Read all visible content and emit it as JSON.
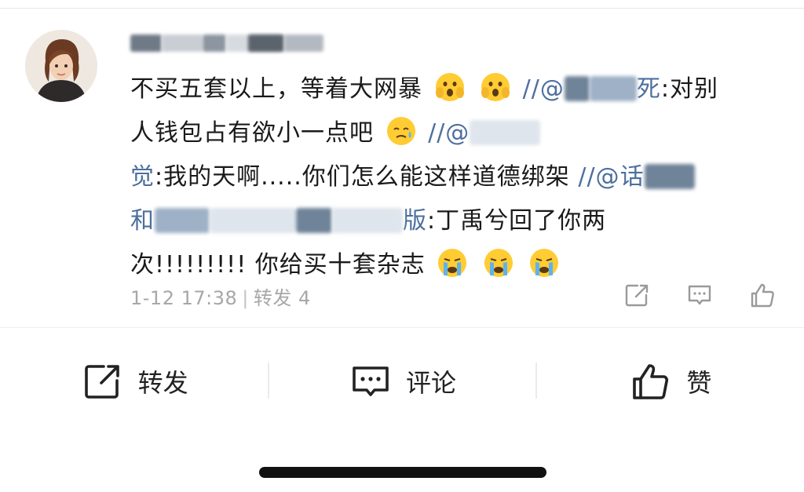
{
  "comment": {
    "line1_text": "不买五套以上，等着大网暴",
    "line1_mention_prefix": "//@",
    "line1_mention_end": "死",
    "line1_tail": ":对别",
    "line2_text": "人钱包占有欲小一点吧",
    "line2_mention_prefix": "//@",
    "line3_mention_start": "觉",
    "line3_text": ":我的天啊.....你们怎么能这样道德绑架",
    "line3_mention_prefix": "//@",
    "line3_mention_tail": "话",
    "line4_mention_start": "和",
    "line4_mention_end": "版",
    "line4_text": ":丁禹兮回了你两",
    "line5_text": "次!!!!!!!!! 你给买十套杂志"
  },
  "meta": {
    "timestamp": "1-12 17:38",
    "separator": "|",
    "repost_count_label": "转发 4"
  },
  "actions": {
    "repost_label": "转发",
    "comment_label": "评论",
    "like_label": "赞"
  },
  "colors": {
    "mention": "#4d6f9e",
    "meta_text": "#a7a7a7",
    "text": "#1a1a1a"
  },
  "icons": {
    "meta": [
      "repost-icon",
      "comment-icon",
      "like-icon"
    ],
    "emoji": [
      "screaming-face-emoji",
      "sweat-face-emoji",
      "loudly-crying-face-emoji"
    ]
  }
}
